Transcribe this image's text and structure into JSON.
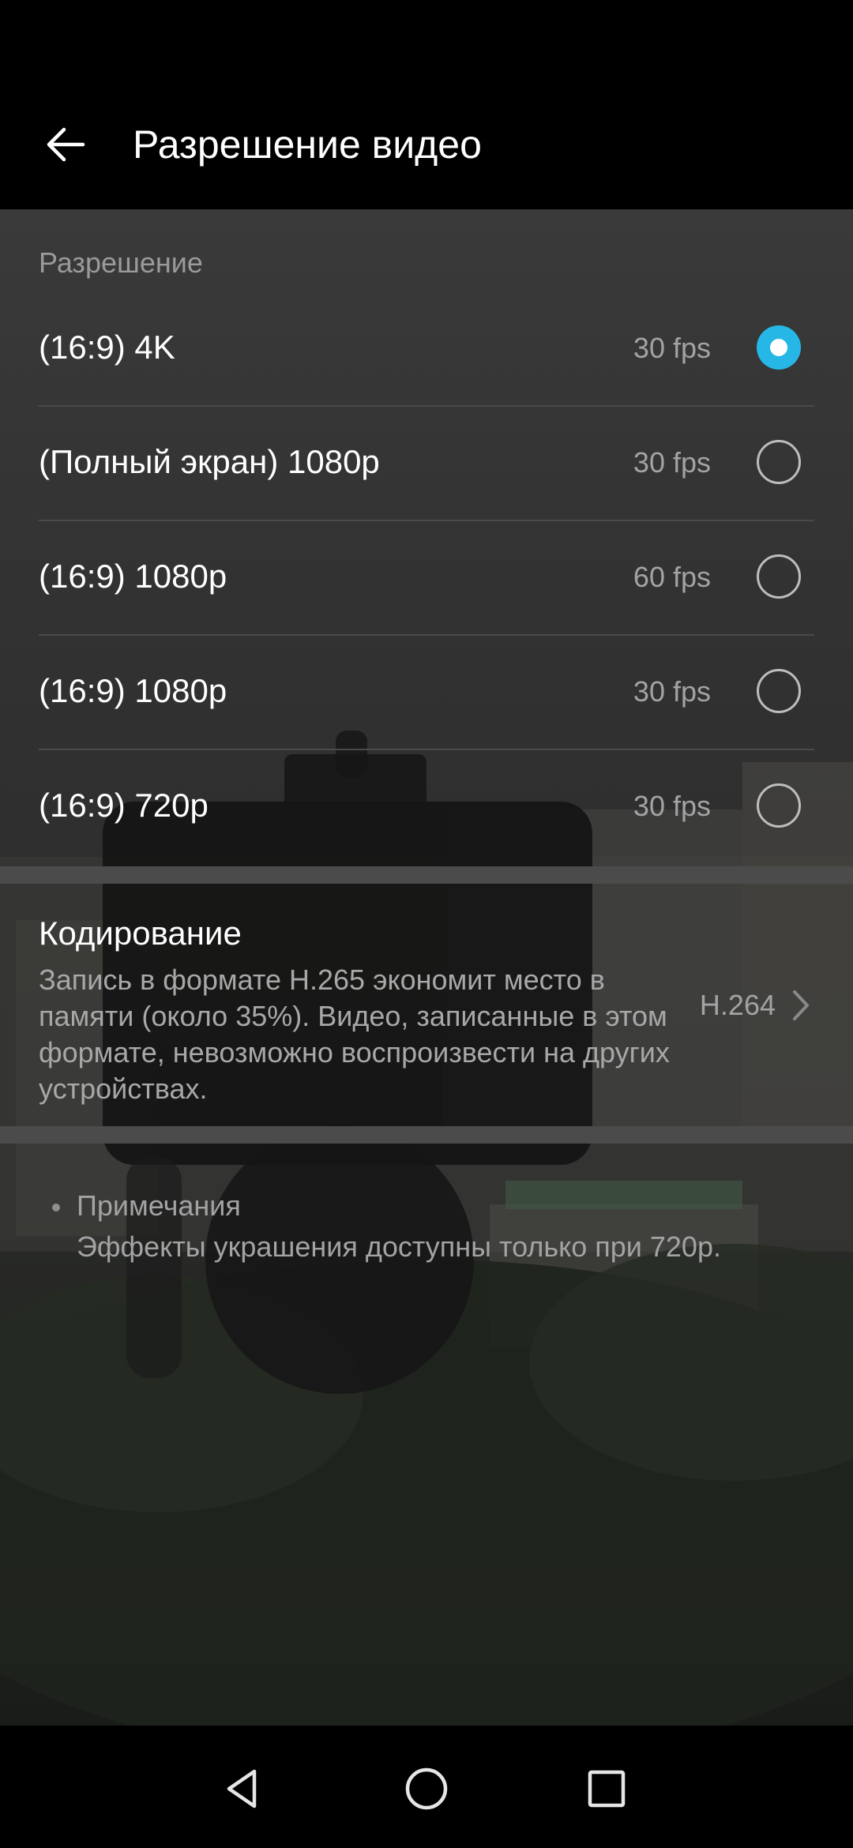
{
  "header": {
    "title": "Разрешение видео"
  },
  "resolution": {
    "section_label": "Разрешение",
    "options": [
      {
        "label": "(16:9) 4K",
        "fps": "30 fps",
        "selected": true
      },
      {
        "label": "(Полный экран) 1080p",
        "fps": "30 fps",
        "selected": false
      },
      {
        "label": "(16:9) 1080p",
        "fps": "60 fps",
        "selected": false
      },
      {
        "label": "(16:9) 1080p",
        "fps": "30 fps",
        "selected": false
      },
      {
        "label": "(16:9) 720p",
        "fps": "30 fps",
        "selected": false
      }
    ]
  },
  "encoding": {
    "title": "Кодирование",
    "description": "Запись в формате H.265 экономит место в памяти (около 35%). Видео, записанные в этом формате, невозможно воспроизвести на других устройствах.",
    "value": "H.264"
  },
  "notes": {
    "title": "Примечания",
    "text": "Эффекты украшения доступны только при 720p."
  },
  "colors": {
    "accent": "#26b7e6",
    "background": "#000000",
    "text_secondary": "#a3a3a3"
  },
  "icons": {
    "back": "arrow-left-icon",
    "chevron": "chevron-right-icon",
    "nav_back": "triangle-back-icon",
    "nav_home": "circle-home-icon",
    "nav_recents": "square-recents-icon"
  }
}
